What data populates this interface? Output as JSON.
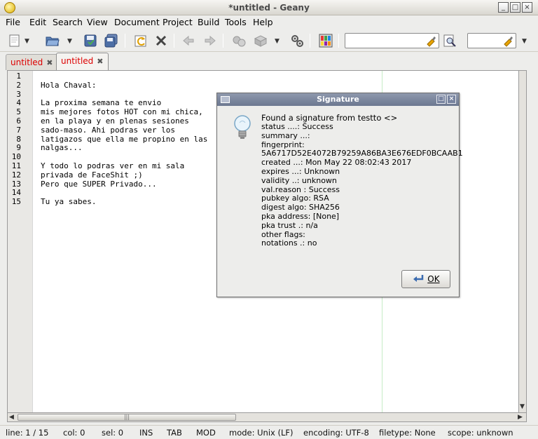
{
  "window": {
    "title": "*untitled - Geany",
    "btn_min": "_",
    "btn_max": "□",
    "btn_close": "×"
  },
  "menu": [
    "File",
    "Edit",
    "Search",
    "View",
    "Document",
    "Project",
    "Build",
    "Tools",
    "Help"
  ],
  "toolbar": {
    "search_value": "",
    "goto_value": ""
  },
  "tabs": [
    {
      "label": "untitled",
      "close": "✖"
    },
    {
      "label": "untitled",
      "close": "✖"
    }
  ],
  "editor": {
    "line_numbers": [
      "1",
      "2",
      "3",
      "4",
      "5",
      "6",
      "7",
      "8",
      "9",
      "10",
      "11",
      "12",
      "13",
      "14",
      "15"
    ],
    "lines": [
      "",
      "Hola Chaval:",
      "",
      "La proxima semana te envio",
      "mis mejores fotos HOT con mi chica,",
      "en la playa y en plenas sesiones",
      "sado-maso. Ahi podras ver los",
      "latigazos que ella me propino en las",
      "nalgas...",
      "",
      "Y todo lo podras ver en mi sala",
      "privada de FaceShit ;)",
      "Pero que SUPER Privado...",
      "",
      "Tu ya sabes."
    ]
  },
  "status": {
    "line": "line: 1 / 15",
    "col": "col: 0",
    "sel": "sel: 0",
    "ins": "INS",
    "tab": "TAB",
    "mod": "MOD",
    "mode": "mode: Unix (LF)",
    "encoding": "encoding: UTF-8",
    "filetype": "filetype: None",
    "scope": "scope: unknown"
  },
  "dialog": {
    "title": "Signature",
    "header": "Found a signature from testto <>",
    "lines": [
      "status ....: Success",
      "summary ...: ",
      "fingerprint:",
      "5A6717D52E4072B79259A86BA3E676EDF0BCAAB1",
      "created ...: Mon May 22 08:02:43 2017",
      "expires ...: Unknown",
      "validity ..: unknown",
      "val.reason : Success",
      "pubkey algo: RSA",
      "digest algo: SHA256",
      "pka address: [None]",
      "pka trust .: n/a",
      "other flags: ",
      "notations .: no"
    ],
    "ok_label": "OK"
  },
  "colors": {
    "tab_text": "#dd0000",
    "long_line_marker": "#c6ecc6"
  }
}
